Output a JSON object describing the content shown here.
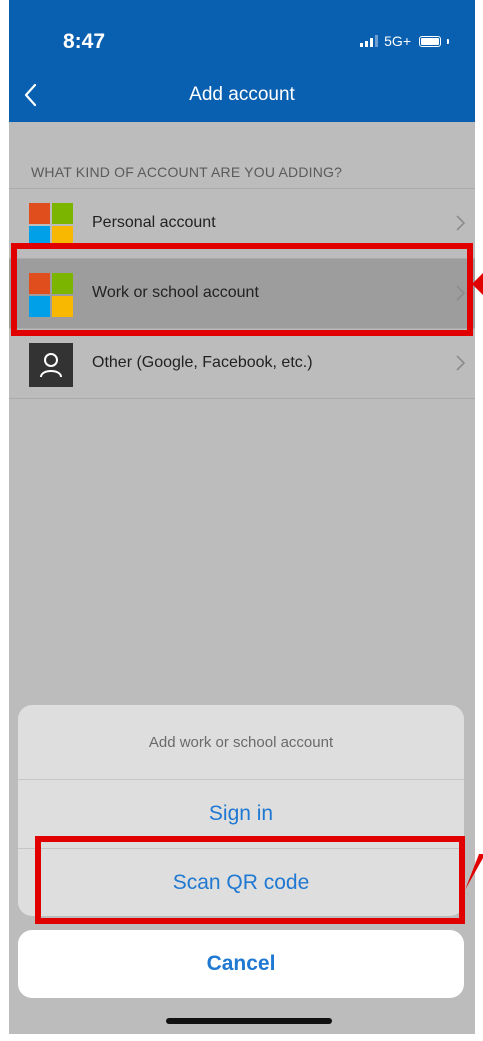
{
  "status_bar": {
    "time": "8:47",
    "network": "5G+"
  },
  "nav": {
    "title": "Add account",
    "back_icon": "chevron-left-icon"
  },
  "section_header": "WHAT KIND OF ACCOUNT ARE YOU ADDING?",
  "accounts": [
    {
      "label": "Personal account",
      "icon": "microsoft-logo-icon"
    },
    {
      "label": "Work or school account",
      "icon": "microsoft-logo-icon",
      "highlighted": true
    },
    {
      "label": "Other (Google, Facebook, etc.)",
      "icon": "person-icon"
    }
  ],
  "action_sheet": {
    "title": "Add work or school account",
    "sign_in": "Sign in",
    "scan_qr": "Scan QR code",
    "cancel": "Cancel"
  },
  "colors": {
    "header_blue": "#0a60b0",
    "action_blue": "#1f78d1",
    "annotation_red": "#e00000",
    "ms_red": "#e14e1e",
    "ms_green": "#7cb500",
    "ms_blue": "#00a0e8",
    "ms_yellow": "#f8b700"
  }
}
